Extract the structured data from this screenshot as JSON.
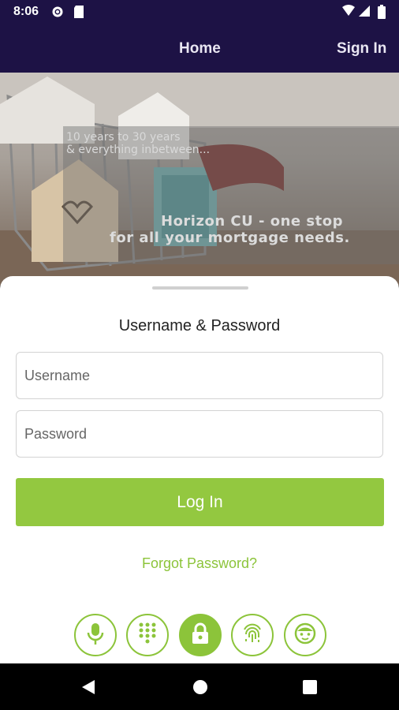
{
  "status_bar": {
    "time": "8:06"
  },
  "nav": {
    "home": "Home",
    "sign_in": "Sign In"
  },
  "hero": {
    "line1": "10 years to 30 years",
    "line2": "& everything inbetween...",
    "headline1": "Horizon CU - one stop",
    "headline2": "for all your mortgage needs."
  },
  "login": {
    "title": "Username & Password",
    "username_placeholder": "Username",
    "password_placeholder": "Password",
    "login_label": "Log In",
    "forgot_label": "Forgot Password?"
  },
  "auth_options": [
    {
      "name": "voice-auth-button",
      "icon": "microphone-icon",
      "active": false
    },
    {
      "name": "pin-auth-button",
      "icon": "keypad-icon",
      "active": false
    },
    {
      "name": "password-auth-button",
      "icon": "lock-icon",
      "active": true
    },
    {
      "name": "fingerprint-auth-button",
      "icon": "fingerprint-icon",
      "active": false
    },
    {
      "name": "face-auth-button",
      "icon": "face-icon",
      "active": false
    }
  ],
  "colors": {
    "brand_dark": "#1d1245",
    "accent_green": "#8cc43a"
  }
}
